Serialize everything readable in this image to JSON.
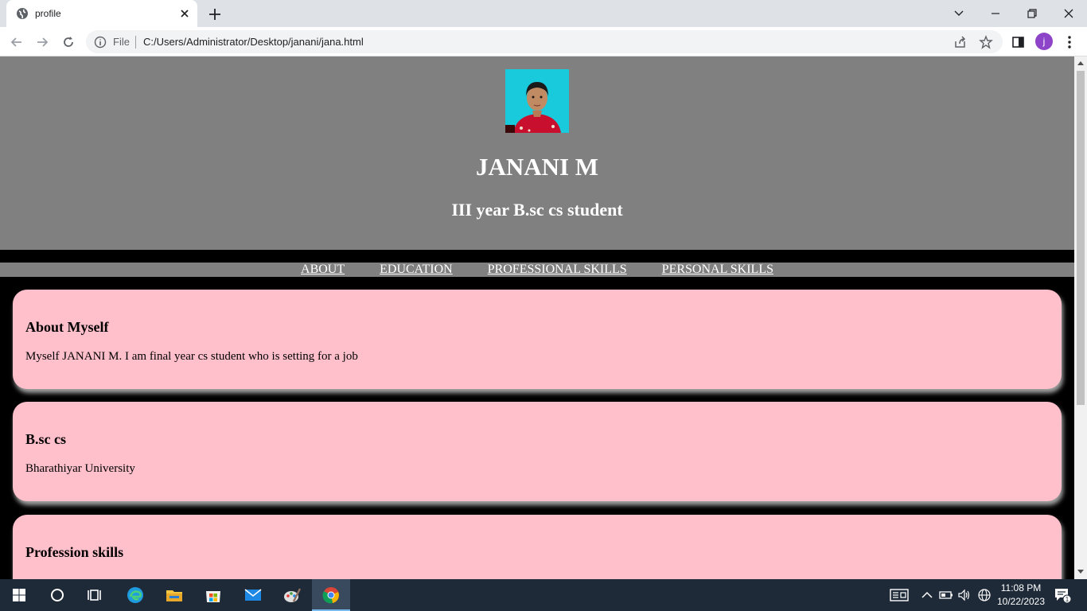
{
  "browser": {
    "tab_title": "profile",
    "url_scheme": "File",
    "url": "C:/Users/Administrator/Desktop/janani/jana.html",
    "profile_initial": "j"
  },
  "header": {
    "name": "JANANI M",
    "subtitle": "III year B.sc cs student"
  },
  "nav": {
    "items": [
      "ABOUT",
      "EDUCATION",
      "PROFESSIONAL SKILLS",
      "PERSONAL SKILLS"
    ]
  },
  "cards": [
    {
      "heading": "About Myself",
      "text": "Myself JANANI M. I am final year cs student who is setting for a job"
    },
    {
      "heading": "B.sc cs",
      "text": "Bharathiyar University"
    },
    {
      "heading": "Profession skills",
      "text": ""
    }
  ],
  "taskbar": {
    "time": "11:08 PM",
    "date": "10/22/2023",
    "notification_count": "1"
  },
  "colors": {
    "card_bg": "#ffc0cb",
    "header_bg": "#808080",
    "page_bg": "#000000"
  }
}
